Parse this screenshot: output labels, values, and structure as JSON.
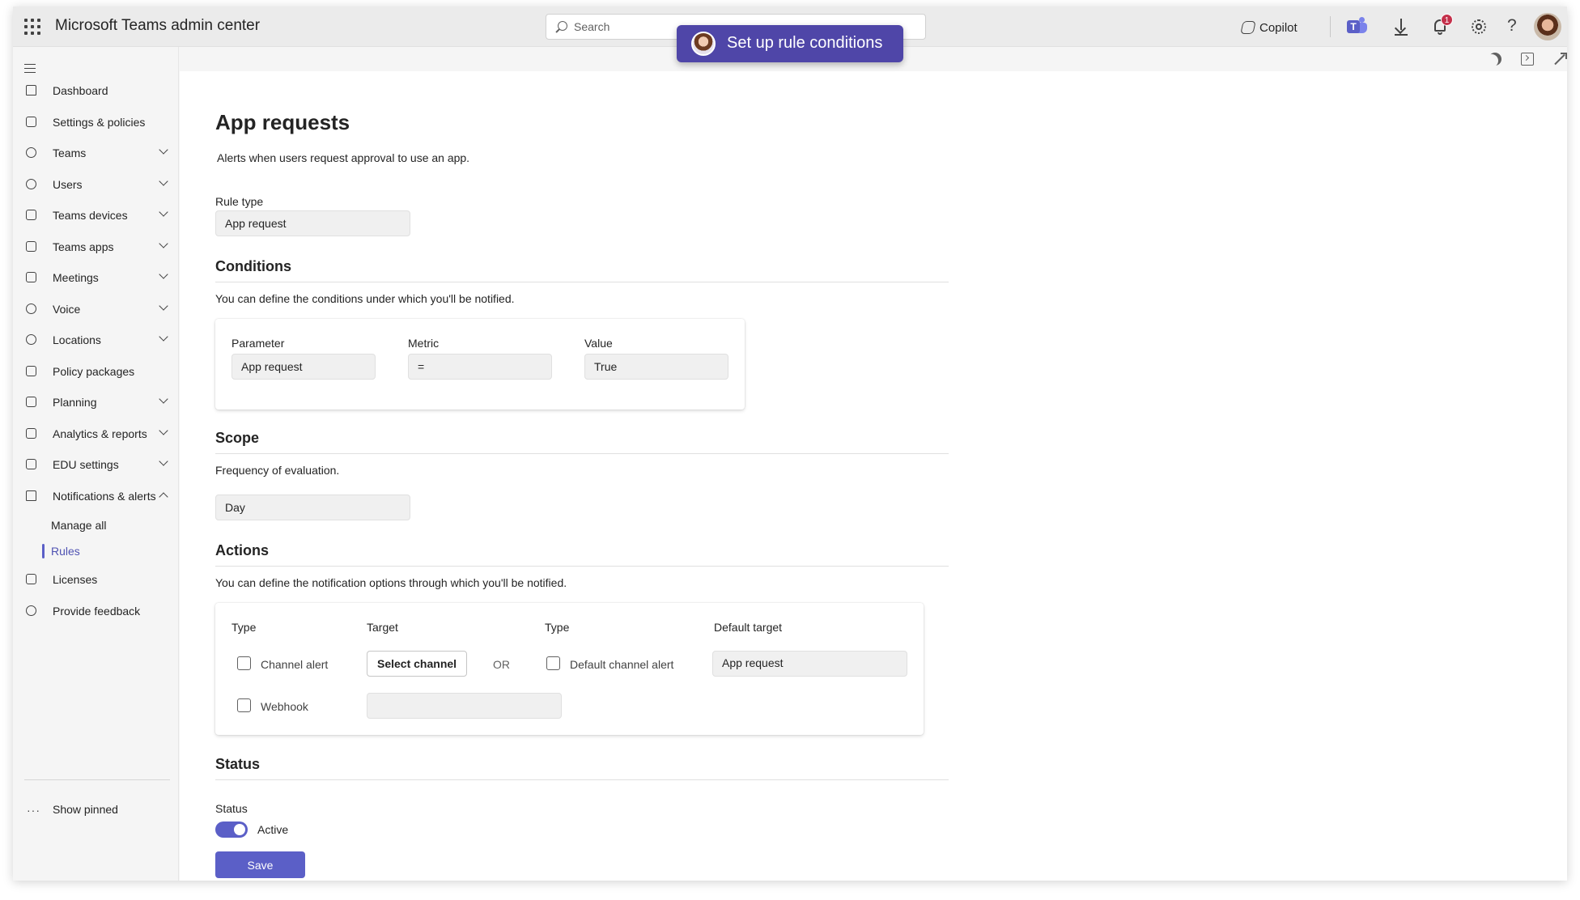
{
  "app": {
    "title": "Microsoft Teams admin center"
  },
  "header": {
    "search_placeholder": "Search",
    "banner_text": "Set up rule conditions",
    "copilot_label": "Copilot",
    "notification_count": "1",
    "help_label": "?"
  },
  "sidebar": {
    "items": [
      {
        "label": "Dashboard",
        "icon": "home-icon"
      },
      {
        "label": "Settings & policies",
        "icon": "settings-policies-icon"
      },
      {
        "label": "Teams",
        "icon": "teams-icon"
      },
      {
        "label": "Users",
        "icon": "users-icon"
      },
      {
        "label": "Teams devices",
        "icon": "devices-icon"
      },
      {
        "label": "Teams apps",
        "icon": "apps-icon"
      },
      {
        "label": "Meetings",
        "icon": "calendar-icon"
      },
      {
        "label": "Voice",
        "icon": "voice-icon"
      },
      {
        "label": "Locations",
        "icon": "globe-icon"
      },
      {
        "label": "Policy packages",
        "icon": "package-icon"
      },
      {
        "label": "Planning",
        "icon": "checklist-icon"
      },
      {
        "label": "Analytics & reports",
        "icon": "chart-icon"
      },
      {
        "label": "EDU settings",
        "icon": "graduation-cap-icon"
      },
      {
        "label": "Notifications & alerts",
        "icon": "bell-icon"
      }
    ],
    "sub_items": [
      {
        "label": "Manage all"
      },
      {
        "label": "Rules"
      }
    ],
    "bottom_items": [
      {
        "label": "Licenses",
        "icon": "licenses-icon"
      },
      {
        "label": "Provide feedback",
        "icon": "feedback-icon"
      }
    ],
    "show_pinned": "Show pinned",
    "show_pinned_glyph": "···"
  },
  "page": {
    "title": "App requests",
    "description": "Alerts when users request approval to use an app.",
    "rule_type_label": "Rule type",
    "rule_type_value": "App request"
  },
  "conditions": {
    "title": "Conditions",
    "description": "You can define the conditions under which you'll be notified.",
    "parameter_label": "Parameter",
    "parameter_value": "App request",
    "metric_label": "Metric",
    "metric_value": "=",
    "value_label": "Value",
    "value_value": "True"
  },
  "scope": {
    "title": "Scope",
    "description": "Frequency of evaluation.",
    "value": "Day"
  },
  "actions": {
    "title": "Actions",
    "description": "You can define the notification options through which you'll be notified.",
    "type_label": "Type",
    "target_label": "Target",
    "type2_label": "Type",
    "default_target_label": "Default target",
    "channel_alert_label": "Channel alert",
    "select_channel_label": "Select channel",
    "or_label": "OR",
    "default_channel_alert_label": "Default channel alert",
    "default_target_value": "App request",
    "webhook_label": "Webhook",
    "webhook_value": ""
  },
  "status": {
    "title": "Status",
    "label": "Status",
    "value": "Active"
  },
  "save_label": "Save",
  "colors": {
    "accent": "#5b5fc7",
    "banner": "#4f46a8",
    "badge": "#c4314b"
  }
}
